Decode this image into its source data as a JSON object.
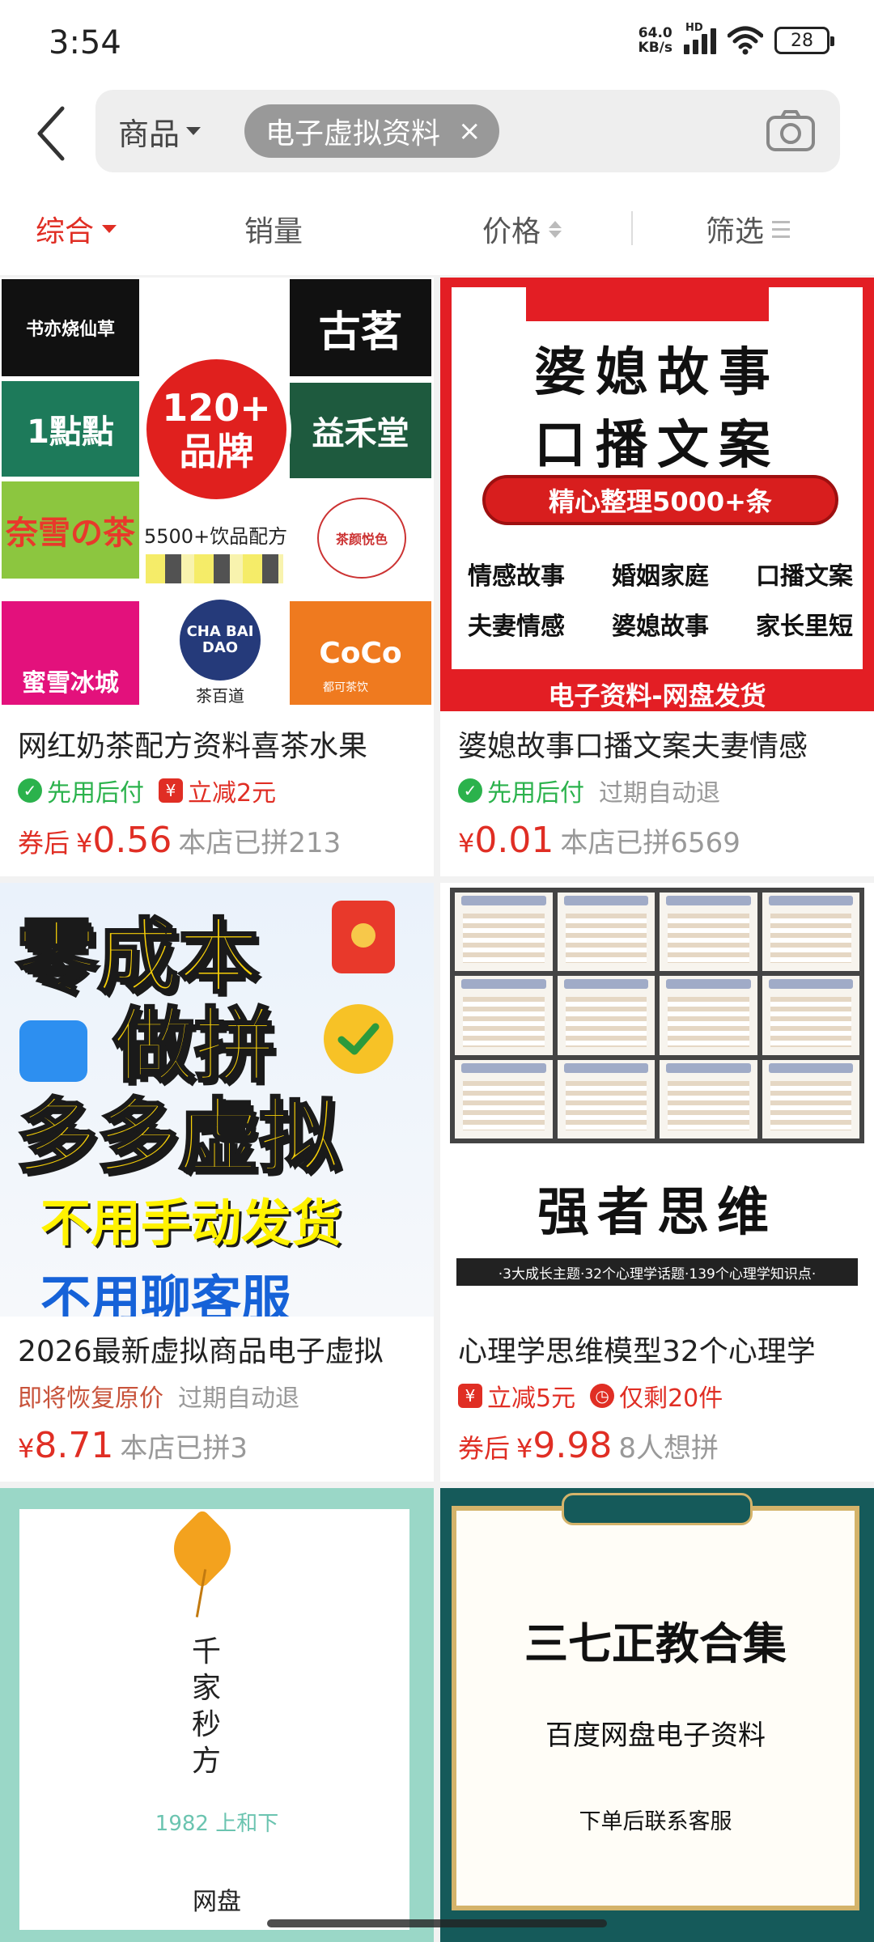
{
  "status_bar": {
    "time": "3:54",
    "net_speed_value": "64.0",
    "net_speed_unit": "KB/s",
    "network": "HD",
    "battery": "28"
  },
  "search": {
    "scope": "商品",
    "chip": "电子虚拟资料",
    "chip_close": "×"
  },
  "sort_bar": {
    "items": [
      "综合",
      "销量",
      "价格",
      "筛选"
    ],
    "active_color": "#e02e24"
  },
  "products": [
    {
      "title": "网红奶茶配方资料喜茶水果",
      "tags": [
        "先用后付",
        "立减2元"
      ],
      "coupon": "券后",
      "currency": "¥",
      "price": "0.56",
      "sold": "本店已拼213",
      "thumb": {
        "brands": [
          "书亦烧仙草",
          "1點點",
          "奈雪の茶",
          "蜜雪冰城",
          "古茗",
          "益禾堂",
          "CHA BAI DAO",
          "茶百道",
          "CoCo",
          "都可茶饮",
          "茶颜悦色"
        ],
        "badge_top": "120+",
        "badge_bottom": "品牌",
        "recipe_text": "5500+饮品配方"
      }
    },
    {
      "title": "婆媳故事口播文案夫妻情感",
      "tags": [
        "先用后付",
        "过期自动退"
      ],
      "coupon": "",
      "currency": "¥",
      "price": "0.01",
      "sold": "本店已拼6569",
      "thumb": {
        "line1": "婆媳故事",
        "line2": "口播文案",
        "pill": "精心整理5000+条",
        "row1": [
          "情感故事",
          "婚姻家庭",
          "口播文案"
        ],
        "row2": [
          "夫妻情感",
          "婆媳故事",
          "家长里短"
        ],
        "footer": "电子资料-网盘发货"
      }
    },
    {
      "title": "2026最新虚拟商品电子虚拟",
      "tags": [
        "即将恢复原价",
        "过期自动退"
      ],
      "coupon": "",
      "currency": "¥",
      "price": "8.71",
      "sold": "本店已拼3",
      "thumb": {
        "line1": "零成本",
        "line2": "做拼",
        "line3": "多多虚拟",
        "line4": "不用手动发货",
        "line5": "不用聊客服"
      }
    },
    {
      "title": "心理学思维模型32个心理学",
      "tags": [
        "立减5元",
        "仅剩20件"
      ],
      "coupon": "券后",
      "currency": "¥",
      "price": "9.98",
      "sold": "8人想拼",
      "thumb": {
        "headline": "强者思维",
        "subline": "·3大成长主题·32个心理学话题·139个心理学知识点·"
      }
    },
    {
      "title": "",
      "thumb": {
        "vertical_title": [
          "千",
          "家",
          "秒",
          "方"
        ],
        "year": "1982  上和下",
        "bottom": "网盘"
      }
    },
    {
      "title": "",
      "thumb": {
        "line1": "三七正教合集",
        "line2": "百度网盘电子资料",
        "line3": "下单后联系客服"
      }
    }
  ],
  "icons": {
    "back": "chevron-left-icon",
    "camera": "camera-icon",
    "filter": "filter-icon"
  }
}
